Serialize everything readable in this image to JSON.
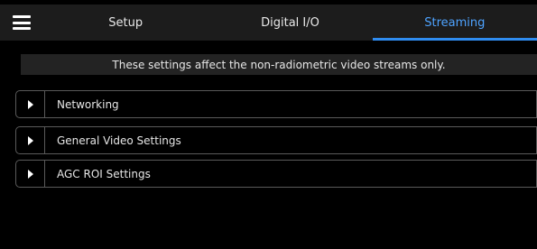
{
  "header": {
    "menu_icon": "hamburger-menu-icon",
    "tabs": [
      {
        "label": "Setup",
        "active": false
      },
      {
        "label": "Digital I/O",
        "active": false
      },
      {
        "label": "Streaming",
        "active": true
      }
    ],
    "active_color": "#4ea3ff"
  },
  "info_banner": {
    "text": "These settings affect the non-radiometric video streams only."
  },
  "sections": [
    {
      "label": "Networking",
      "icon": "expand-arrow-icon",
      "expanded": false
    },
    {
      "label": "General Video Settings",
      "icon": "expand-arrow-icon",
      "expanded": false
    },
    {
      "label": "AGC ROI Settings",
      "icon": "expand-arrow-icon",
      "expanded": false
    }
  ]
}
